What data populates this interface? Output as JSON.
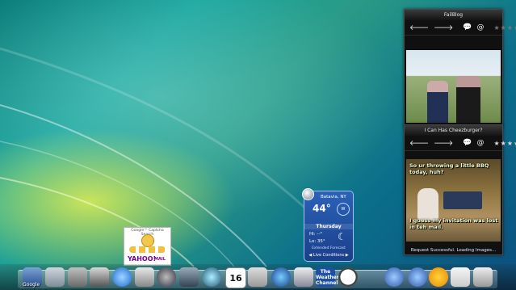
{
  "failblog": {
    "title": "FailBlog",
    "nav": {
      "back": "🡐",
      "forward": "🡒",
      "comment": "💬",
      "email": "@"
    },
    "rating": "★★★★★"
  },
  "cheezburger": {
    "title": "I Can Has Cheezburger?",
    "nav": {
      "back": "🡐",
      "forward": "🡒",
      "comment": "💬",
      "email": "@"
    },
    "rating": "★★★★★",
    "caption_top": "So ur throwing a little BBQ today, huh?",
    "caption_bottom": "I guess my invitation was lost in teh mail.",
    "status": "Request Successful. Loading Images..."
  },
  "weather": {
    "city": "Batavia, NY",
    "temp": "44°",
    "wind_dir": "W",
    "day": "Thursday",
    "hi": "Hi: --°",
    "lo": "Lo: 35°",
    "extended": "Extended Forecast",
    "live": "Live Conditions",
    "prev": "◀",
    "next": "▶"
  },
  "captcha": {
    "title": "Google™ Captcha Search",
    "yahoo": "YAHOO!",
    "mail": "MAIL"
  },
  "dock": {
    "google_label": "Google",
    "calendar_day": "16",
    "weather_channel": "The Weather Channel"
  },
  "colors": {
    "accent": "#1d4fa8",
    "window_dark": "#101010"
  }
}
